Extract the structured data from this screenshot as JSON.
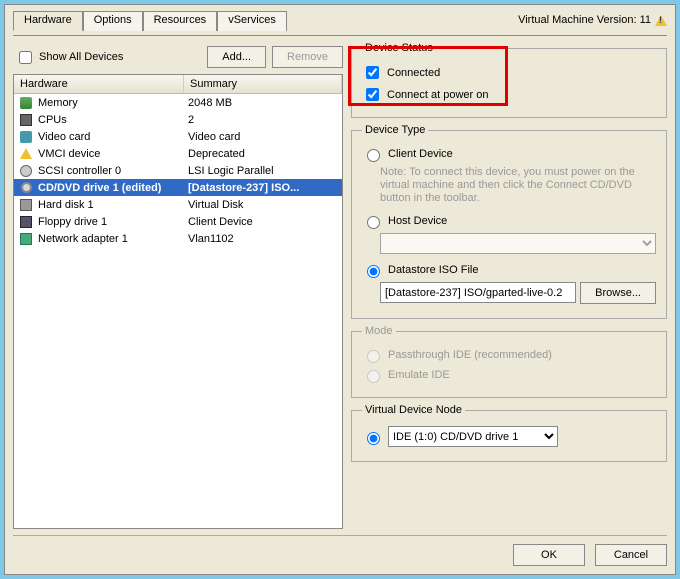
{
  "tabs": [
    "Hardware",
    "Options",
    "Resources",
    "vServices"
  ],
  "activeTab": 0,
  "version_label": "Virtual Machine Version: 11",
  "show_all_label": "Show All Devices",
  "add_label": "Add...",
  "remove_label": "Remove",
  "hw_head": {
    "c1": "Hardware",
    "c2": "Summary"
  },
  "hw": [
    {
      "icon": "ico-mem",
      "name": "Memory",
      "summary": "2048 MB"
    },
    {
      "icon": "ico-cpu",
      "name": "CPUs",
      "summary": "2"
    },
    {
      "icon": "ico-video",
      "name": "Video card",
      "summary": "Video card"
    },
    {
      "icon": "ico-vmci",
      "name": "VMCI device",
      "summary": "Deprecated"
    },
    {
      "icon": "ico-scsi",
      "name": "SCSI controller 0",
      "summary": "LSI Logic Parallel"
    },
    {
      "icon": "ico-cd",
      "name": "CD/DVD drive 1 (edited)",
      "summary": "[Datastore-237] ISO..."
    },
    {
      "icon": "ico-hd",
      "name": "Hard disk 1",
      "summary": "Virtual Disk"
    },
    {
      "icon": "ico-floppy",
      "name": "Floppy drive 1",
      "summary": "Client Device"
    },
    {
      "icon": "ico-nic",
      "name": "Network adapter 1",
      "summary": "Vlan1102"
    }
  ],
  "selected_hw": 5,
  "status": {
    "legend": "Device Status",
    "connected": "Connected",
    "power_on": "Connect at power on"
  },
  "devtype": {
    "legend": "Device Type",
    "client": "Client Device",
    "client_note": "Note: To connect this device, you must power on the virtual machine and then click the Connect CD/DVD button in the toolbar.",
    "host": "Host Device",
    "datastore": "Datastore ISO File",
    "iso_path": "[Datastore-237] ISO/gparted-live-0.2",
    "browse": "Browse..."
  },
  "mode": {
    "legend": "Mode",
    "passthrough": "Passthrough IDE (recommended)",
    "emulate": "Emulate IDE"
  },
  "vdn": {
    "legend": "Virtual Device Node",
    "value": "IDE (1:0) CD/DVD drive 1"
  },
  "footer": {
    "ok": "OK",
    "cancel": "Cancel"
  }
}
